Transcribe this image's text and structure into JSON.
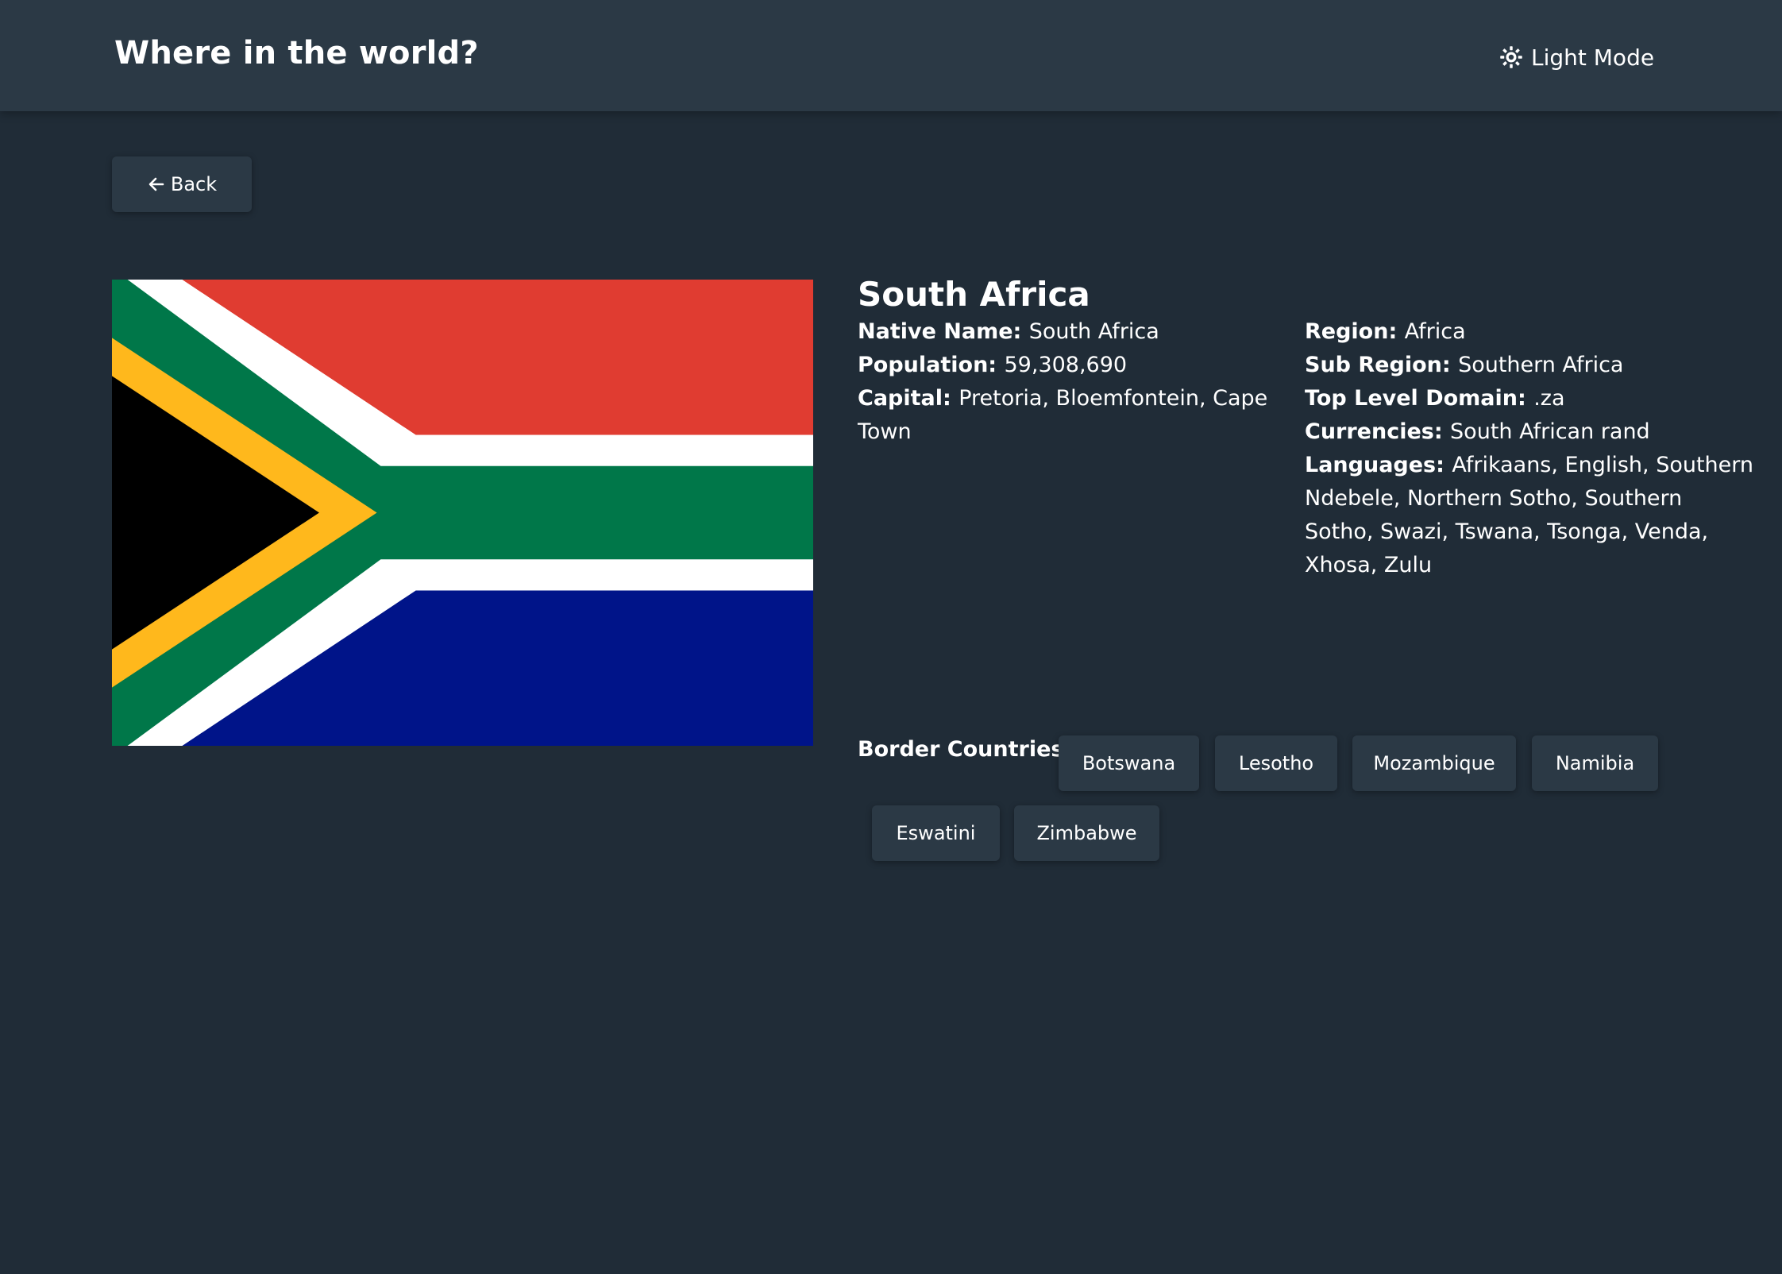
{
  "header": {
    "title": "Where in the world?",
    "theme_toggle_label": "Light Mode",
    "theme_toggle_icon": "sun-icon"
  },
  "back_button": {
    "label": "Back",
    "icon": "arrow-left-icon"
  },
  "country": {
    "name": "South Africa",
    "flag_colors": {
      "red": "#e03c31",
      "green": "#007749",
      "blue": "#001489",
      "gold": "#ffb81c",
      "black": "#000000",
      "white": "#ffffff"
    },
    "details_left": [
      {
        "label": "Native Name:",
        "value": "South Africa"
      },
      {
        "label": "Population:",
        "value": "59,308,690"
      },
      {
        "label": "Capital:",
        "value": "Pretoria, Bloemfontein, Cape Town"
      }
    ],
    "details_right": [
      {
        "label": "Region:",
        "value": "Africa"
      },
      {
        "label": "Sub Region:",
        "value": "Southern Africa"
      },
      {
        "label": "Top Level Domain:",
        "value": ".za"
      },
      {
        "label": "Currencies:",
        "value": "South African rand"
      },
      {
        "label": "Languages:",
        "value": "Afrikaans, English, Southern Ndebele, Northern Sotho, Southern Sotho, Swazi, Tswana, Tsonga, Venda, Xhosa, Zulu"
      }
    ],
    "border_label": "Border Countries:",
    "borders": [
      "Botswana",
      "Lesotho",
      "Mozambique",
      "Namibia",
      "Eswatini",
      "Zimbabwe"
    ]
  },
  "colors": {
    "background": "#202c37",
    "elements": "#2b3945",
    "text": "#ffffff"
  }
}
